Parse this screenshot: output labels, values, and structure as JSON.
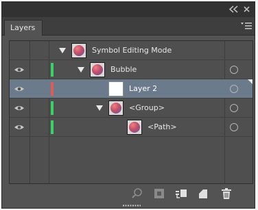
{
  "panel": {
    "tab_label": "Layers"
  },
  "colors": {
    "panel_bg": "#535353",
    "selected_row": "#6b7b8c",
    "layer_green": "#3ad16a",
    "layer_red": "#e05a5a"
  },
  "rows": [
    {
      "name": "Symbol Editing Mode",
      "visible": false,
      "color": "",
      "expanded": true,
      "thumb": "orb",
      "selected": false
    },
    {
      "name": "Bubble",
      "visible": true,
      "color": "green",
      "expanded": true,
      "thumb": "orb",
      "selected": false
    },
    {
      "name": "Layer 2",
      "visible": true,
      "color": "red",
      "expanded": false,
      "thumb": "blank",
      "selected": true
    },
    {
      "name": "<Group>",
      "visible": true,
      "color": "green",
      "expanded": true,
      "thumb": "orb",
      "selected": false
    },
    {
      "name": "<Path>",
      "visible": true,
      "color": "green",
      "expanded": false,
      "thumb": "orb",
      "selected": false
    }
  ],
  "footer_icons": [
    "locate-object-icon",
    "make-clipping-mask-icon",
    "create-sublayer-icon",
    "create-new-layer-icon",
    "trash-icon"
  ]
}
